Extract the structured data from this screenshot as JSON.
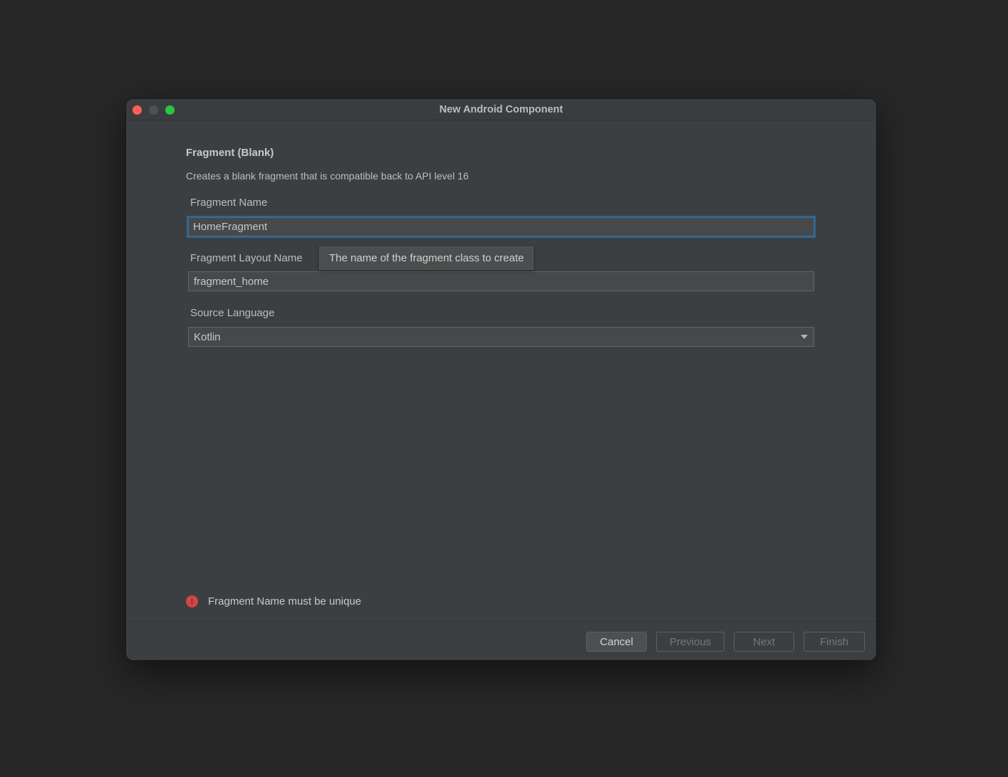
{
  "window": {
    "title": "New Android Component",
    "colors": {
      "close": "#ff5f57",
      "minimize": "#4f5152",
      "zoom": "#28c840"
    }
  },
  "content": {
    "heading": "Fragment (Blank)",
    "description": "Creates a blank fragment that is compatible back to API level 16"
  },
  "form": {
    "fragment_name": {
      "label": "Fragment Name",
      "value": "HomeFragment"
    },
    "layout_name": {
      "label": "Fragment Layout Name",
      "value": "fragment_home"
    },
    "source_language": {
      "label": "Source Language",
      "value": "Kotlin"
    }
  },
  "tooltip": {
    "text": "The name of the fragment class to create"
  },
  "error": {
    "icon": "exclamation-icon",
    "text": "Fragment Name must be unique"
  },
  "buttons": {
    "cancel": "Cancel",
    "previous": "Previous",
    "next": "Next",
    "finish": "Finish"
  }
}
